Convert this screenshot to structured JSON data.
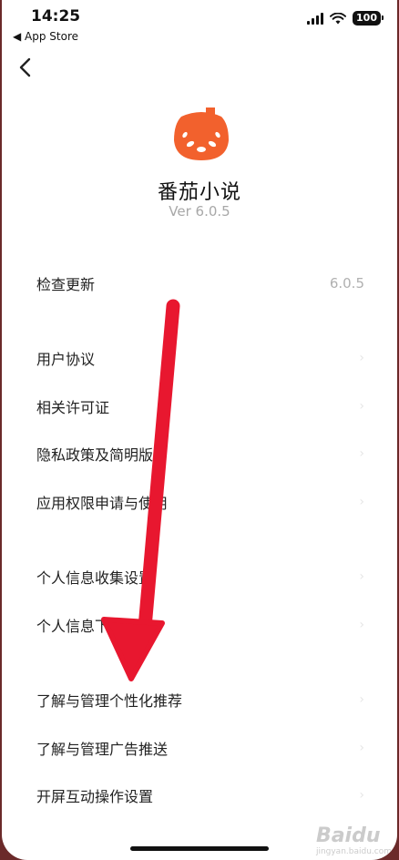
{
  "status_bar": {
    "time": "14:25",
    "back_app": "◀ App Store",
    "battery": "100"
  },
  "app": {
    "name": "番茄小说",
    "version": "Ver 6.0.5",
    "logo_color": "#f2612d"
  },
  "menu": {
    "check_update": {
      "label": "检查更新",
      "value": "6.0.5"
    },
    "user_agreement": "用户协议",
    "licenses": "相关许可证",
    "privacy_policy": "隐私政策及简明版",
    "permissions": "应用权限申请与使用",
    "info_collection": "个人信息收集设置",
    "info_download": "个人信息下载",
    "personalization": "了解与管理个性化推荐",
    "ads": "了解与管理广告推送",
    "splash_interaction": "开屏互动操作设置"
  },
  "annotation_color": "#e8172f",
  "watermark": {
    "brand": "Baidu",
    "sub": "jingyan.baidu.com"
  }
}
